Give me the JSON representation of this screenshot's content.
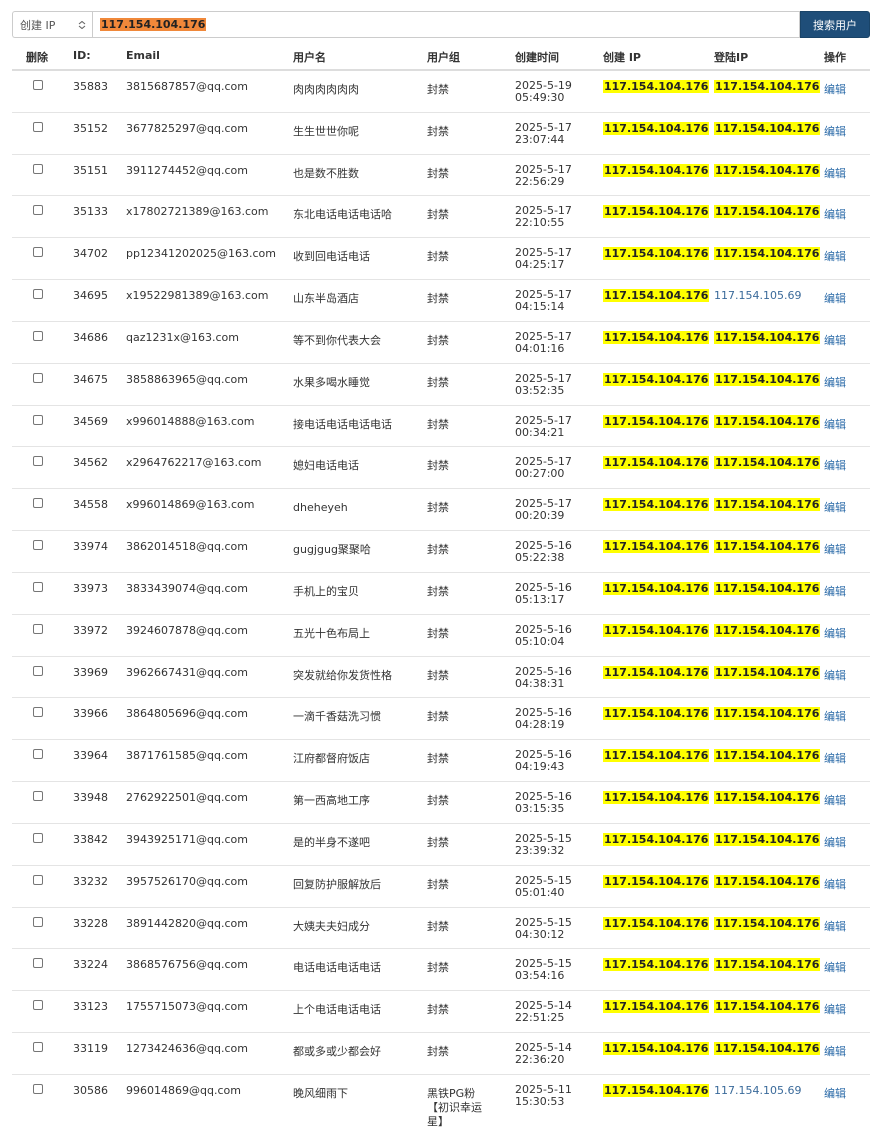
{
  "search": {
    "field_select": "创建 IP",
    "query": "117.154.104.176",
    "button": "搜索用户"
  },
  "columns": [
    "删除",
    "ID:",
    "Email",
    "用户名",
    "用户组",
    "创建时间",
    "创建 IP",
    "登陆IP",
    "操作"
  ],
  "rows": [
    {
      "id": "35883",
      "email": "3815687857@qq.com",
      "username": "肉肉肉肉肉肉",
      "group": "封禁",
      "date": "2025-5-19",
      "time": "05:49:30",
      "create_ip": "117.154.104.176",
      "create_ip_hl": true,
      "login_ip": "117.154.104.176",
      "login_ip_hl": true,
      "op": "编辑"
    },
    {
      "id": "35152",
      "email": "3677825297@qq.com",
      "username": "生生世世你呢",
      "group": "封禁",
      "date": "2025-5-17",
      "time": "23:07:44",
      "create_ip": "117.154.104.176",
      "create_ip_hl": true,
      "login_ip": "117.154.104.176",
      "login_ip_hl": true,
      "op": "编辑"
    },
    {
      "id": "35151",
      "email": "3911274452@qq.com",
      "username": "也是数不胜数",
      "group": "封禁",
      "date": "2025-5-17",
      "time": "22:56:29",
      "create_ip": "117.154.104.176",
      "create_ip_hl": true,
      "login_ip": "117.154.104.176",
      "login_ip_hl": true,
      "op": "编辑"
    },
    {
      "id": "35133",
      "email": "x17802721389@163.com",
      "username": "东北电话电话电话哈",
      "group": "封禁",
      "date": "2025-5-17",
      "time": "22:10:55",
      "create_ip": "117.154.104.176",
      "create_ip_hl": true,
      "login_ip": "117.154.104.176",
      "login_ip_hl": true,
      "op": "编辑"
    },
    {
      "id": "34702",
      "email": "pp12341202025@163.com",
      "username": "收到回电话电话",
      "group": "封禁",
      "date": "2025-5-17",
      "time": "04:25:17",
      "create_ip": "117.154.104.176",
      "create_ip_hl": true,
      "login_ip": "117.154.104.176",
      "login_ip_hl": true,
      "op": "编辑"
    },
    {
      "id": "34695",
      "email": "x19522981389@163.com",
      "username": "山东半岛酒店",
      "group": "封禁",
      "date": "2025-5-17",
      "time": "04:15:14",
      "create_ip": "117.154.104.176",
      "create_ip_hl": true,
      "login_ip": "117.154.105.69",
      "login_ip_hl": false,
      "op": "编辑"
    },
    {
      "id": "34686",
      "email": "qaz1231x@163.com",
      "username": "等不到你代表大会",
      "group": "封禁",
      "date": "2025-5-17",
      "time": "04:01:16",
      "create_ip": "117.154.104.176",
      "create_ip_hl": true,
      "login_ip": "117.154.104.176",
      "login_ip_hl": true,
      "op": "编辑"
    },
    {
      "id": "34675",
      "email": "3858863965@qq.com",
      "username": "水果多喝水睡觉",
      "group": "封禁",
      "date": "2025-5-17",
      "time": "03:52:35",
      "create_ip": "117.154.104.176",
      "create_ip_hl": true,
      "login_ip": "117.154.104.176",
      "login_ip_hl": true,
      "op": "编辑"
    },
    {
      "id": "34569",
      "email": "x996014888@163.com",
      "username": "接电话电话电话电话",
      "group": "封禁",
      "date": "2025-5-17",
      "time": "00:34:21",
      "create_ip": "117.154.104.176",
      "create_ip_hl": true,
      "login_ip": "117.154.104.176",
      "login_ip_hl": true,
      "op": "编辑"
    },
    {
      "id": "34562",
      "email": "x2964762217@163.com",
      "username": "媳妇电话电话",
      "group": "封禁",
      "date": "2025-5-17",
      "time": "00:27:00",
      "create_ip": "117.154.104.176",
      "create_ip_hl": true,
      "login_ip": "117.154.104.176",
      "login_ip_hl": true,
      "op": "编辑"
    },
    {
      "id": "34558",
      "email": "x996014869@163.com",
      "username": "dheheyeh",
      "group": "封禁",
      "date": "2025-5-17",
      "time": "00:20:39",
      "create_ip": "117.154.104.176",
      "create_ip_hl": true,
      "login_ip": "117.154.104.176",
      "login_ip_hl": true,
      "op": "编辑"
    },
    {
      "id": "33974",
      "email": "3862014518@qq.com",
      "username": "gugjgug聚聚哈",
      "group": "封禁",
      "date": "2025-5-16",
      "time": "05:22:38",
      "create_ip": "117.154.104.176",
      "create_ip_hl": true,
      "login_ip": "117.154.104.176",
      "login_ip_hl": true,
      "op": "编辑"
    },
    {
      "id": "33973",
      "email": "3833439074@qq.com",
      "username": "手机上的宝贝",
      "group": "封禁",
      "date": "2025-5-16",
      "time": "05:13:17",
      "create_ip": "117.154.104.176",
      "create_ip_hl": true,
      "login_ip": "117.154.104.176",
      "login_ip_hl": true,
      "op": "编辑"
    },
    {
      "id": "33972",
      "email": "3924607878@qq.com",
      "username": "五光十色布局上",
      "group": "封禁",
      "date": "2025-5-16",
      "time": "05:10:04",
      "create_ip": "117.154.104.176",
      "create_ip_hl": true,
      "login_ip": "117.154.104.176",
      "login_ip_hl": true,
      "op": "编辑"
    },
    {
      "id": "33969",
      "email": "3962667431@qq.com",
      "username": "突发就给你发货性格",
      "group": "封禁",
      "date": "2025-5-16",
      "time": "04:38:31",
      "create_ip": "117.154.104.176",
      "create_ip_hl": true,
      "login_ip": "117.154.104.176",
      "login_ip_hl": true,
      "op": "编辑"
    },
    {
      "id": "33966",
      "email": "3864805696@qq.com",
      "username": "一滴千香菇洗习惯",
      "group": "封禁",
      "date": "2025-5-16",
      "time": "04:28:19",
      "create_ip": "117.154.104.176",
      "create_ip_hl": true,
      "login_ip": "117.154.104.176",
      "login_ip_hl": true,
      "op": "编辑"
    },
    {
      "id": "33964",
      "email": "3871761585@qq.com",
      "username": "江府都督府饭店",
      "group": "封禁",
      "date": "2025-5-16",
      "time": "04:19:43",
      "create_ip": "117.154.104.176",
      "create_ip_hl": true,
      "login_ip": "117.154.104.176",
      "login_ip_hl": true,
      "op": "编辑"
    },
    {
      "id": "33948",
      "email": "2762922501@qq.com",
      "username": "第一西高地工序",
      "group": "封禁",
      "date": "2025-5-16",
      "time": "03:15:35",
      "create_ip": "117.154.104.176",
      "create_ip_hl": true,
      "login_ip": "117.154.104.176",
      "login_ip_hl": true,
      "op": "编辑"
    },
    {
      "id": "33842",
      "email": "3943925171@qq.com",
      "username": "是的半身不遂吧",
      "group": "封禁",
      "date": "2025-5-15",
      "time": "23:39:32",
      "create_ip": "117.154.104.176",
      "create_ip_hl": true,
      "login_ip": "117.154.104.176",
      "login_ip_hl": true,
      "op": "编辑"
    },
    {
      "id": "33232",
      "email": "3957526170@qq.com",
      "username": "回复防护服解放后",
      "group": "封禁",
      "date": "2025-5-15",
      "time": "05:01:40",
      "create_ip": "117.154.104.176",
      "create_ip_hl": true,
      "login_ip": "117.154.104.176",
      "login_ip_hl": true,
      "op": "编辑"
    },
    {
      "id": "33228",
      "email": "3891442820@qq.com",
      "username": "大姨夫夫妇成分",
      "group": "封禁",
      "date": "2025-5-15",
      "time": "04:30:12",
      "create_ip": "117.154.104.176",
      "create_ip_hl": true,
      "login_ip": "117.154.104.176",
      "login_ip_hl": true,
      "op": "编辑"
    },
    {
      "id": "33224",
      "email": "3868576756@qq.com",
      "username": "电话电话电话电话",
      "group": "封禁",
      "date": "2025-5-15",
      "time": "03:54:16",
      "create_ip": "117.154.104.176",
      "create_ip_hl": true,
      "login_ip": "117.154.104.176",
      "login_ip_hl": true,
      "op": "编辑"
    },
    {
      "id": "33123",
      "email": "1755715073@qq.com",
      "username": "上个电话电话电话",
      "group": "封禁",
      "date": "2025-5-14",
      "time": "22:51:25",
      "create_ip": "117.154.104.176",
      "create_ip_hl": true,
      "login_ip": "117.154.104.176",
      "login_ip_hl": true,
      "op": "编辑"
    },
    {
      "id": "33119",
      "email": "1273424636@qq.com",
      "username": "都或多或少都会好",
      "group": "封禁",
      "date": "2025-5-14",
      "time": "22:36:20",
      "create_ip": "117.154.104.176",
      "create_ip_hl": true,
      "login_ip": "117.154.104.176",
      "login_ip_hl": true,
      "op": "编辑"
    },
    {
      "id": "30586",
      "email": "996014869@qq.com",
      "username": "晚风细雨下",
      "group": "黑铁PG粉【初识幸运星】",
      "date": "2025-5-11",
      "time": "15:30:53",
      "create_ip": "117.154.104.176",
      "create_ip_hl": true,
      "login_ip": "117.154.105.69",
      "login_ip_hl": false,
      "op": "编辑"
    }
  ],
  "colors": {
    "search_button_bg": "#1f4e79",
    "query_highlight": "#f0883a",
    "ip_highlight": "#ffff00",
    "link": "#2a6aa8"
  }
}
